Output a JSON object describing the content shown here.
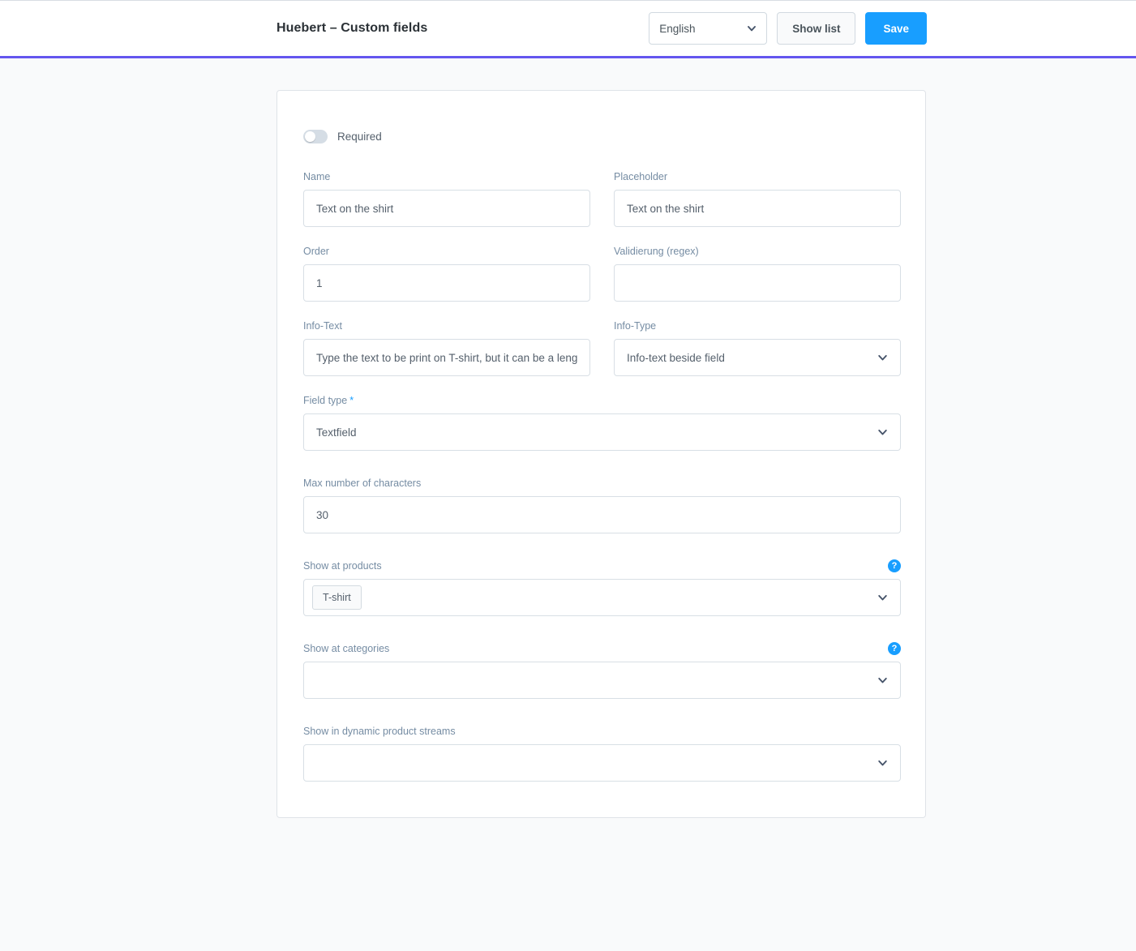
{
  "topbar": {
    "title": "Huebert – Custom fields",
    "language_value": "English",
    "show_list_label": "Show list",
    "save_label": "Save",
    "accent_purple": "#6456ef",
    "primary_blue": "#189eff"
  },
  "form": {
    "required_toggle": {
      "label": "Required",
      "state": "off"
    },
    "name": {
      "label": "Name",
      "value": "Text on the shirt",
      "placeholder": ""
    },
    "placeholder_field": {
      "label": "Placeholder",
      "value": "Text on the shirt",
      "placeholder": ""
    },
    "order": {
      "label": "Order",
      "value": "1",
      "placeholder": ""
    },
    "validation": {
      "label": "Validierung (regex)",
      "value": "",
      "placeholder": ""
    },
    "info_text": {
      "label": "Info-Text",
      "value": "Type the text to be print on T-shirt, but it can be a lengthy text",
      "placeholder": ""
    },
    "info_type": {
      "label": "Info-Type",
      "value": "Info-text beside field"
    },
    "field_type": {
      "label": "Field type",
      "required_marker": "*",
      "value": "Textfield"
    },
    "max_chars": {
      "label": "Max number of characters",
      "value": "30",
      "placeholder": ""
    },
    "show_at_products": {
      "label": "Show at products",
      "help": "?",
      "chips": [
        "T-shirt"
      ]
    },
    "show_at_categories": {
      "label": "Show at categories",
      "help": "?",
      "chips": []
    },
    "show_in_streams": {
      "label": "Show in dynamic product streams",
      "chips": []
    }
  },
  "icons": {
    "chevron_down": "chevron-down-icon",
    "help": "help-icon"
  }
}
